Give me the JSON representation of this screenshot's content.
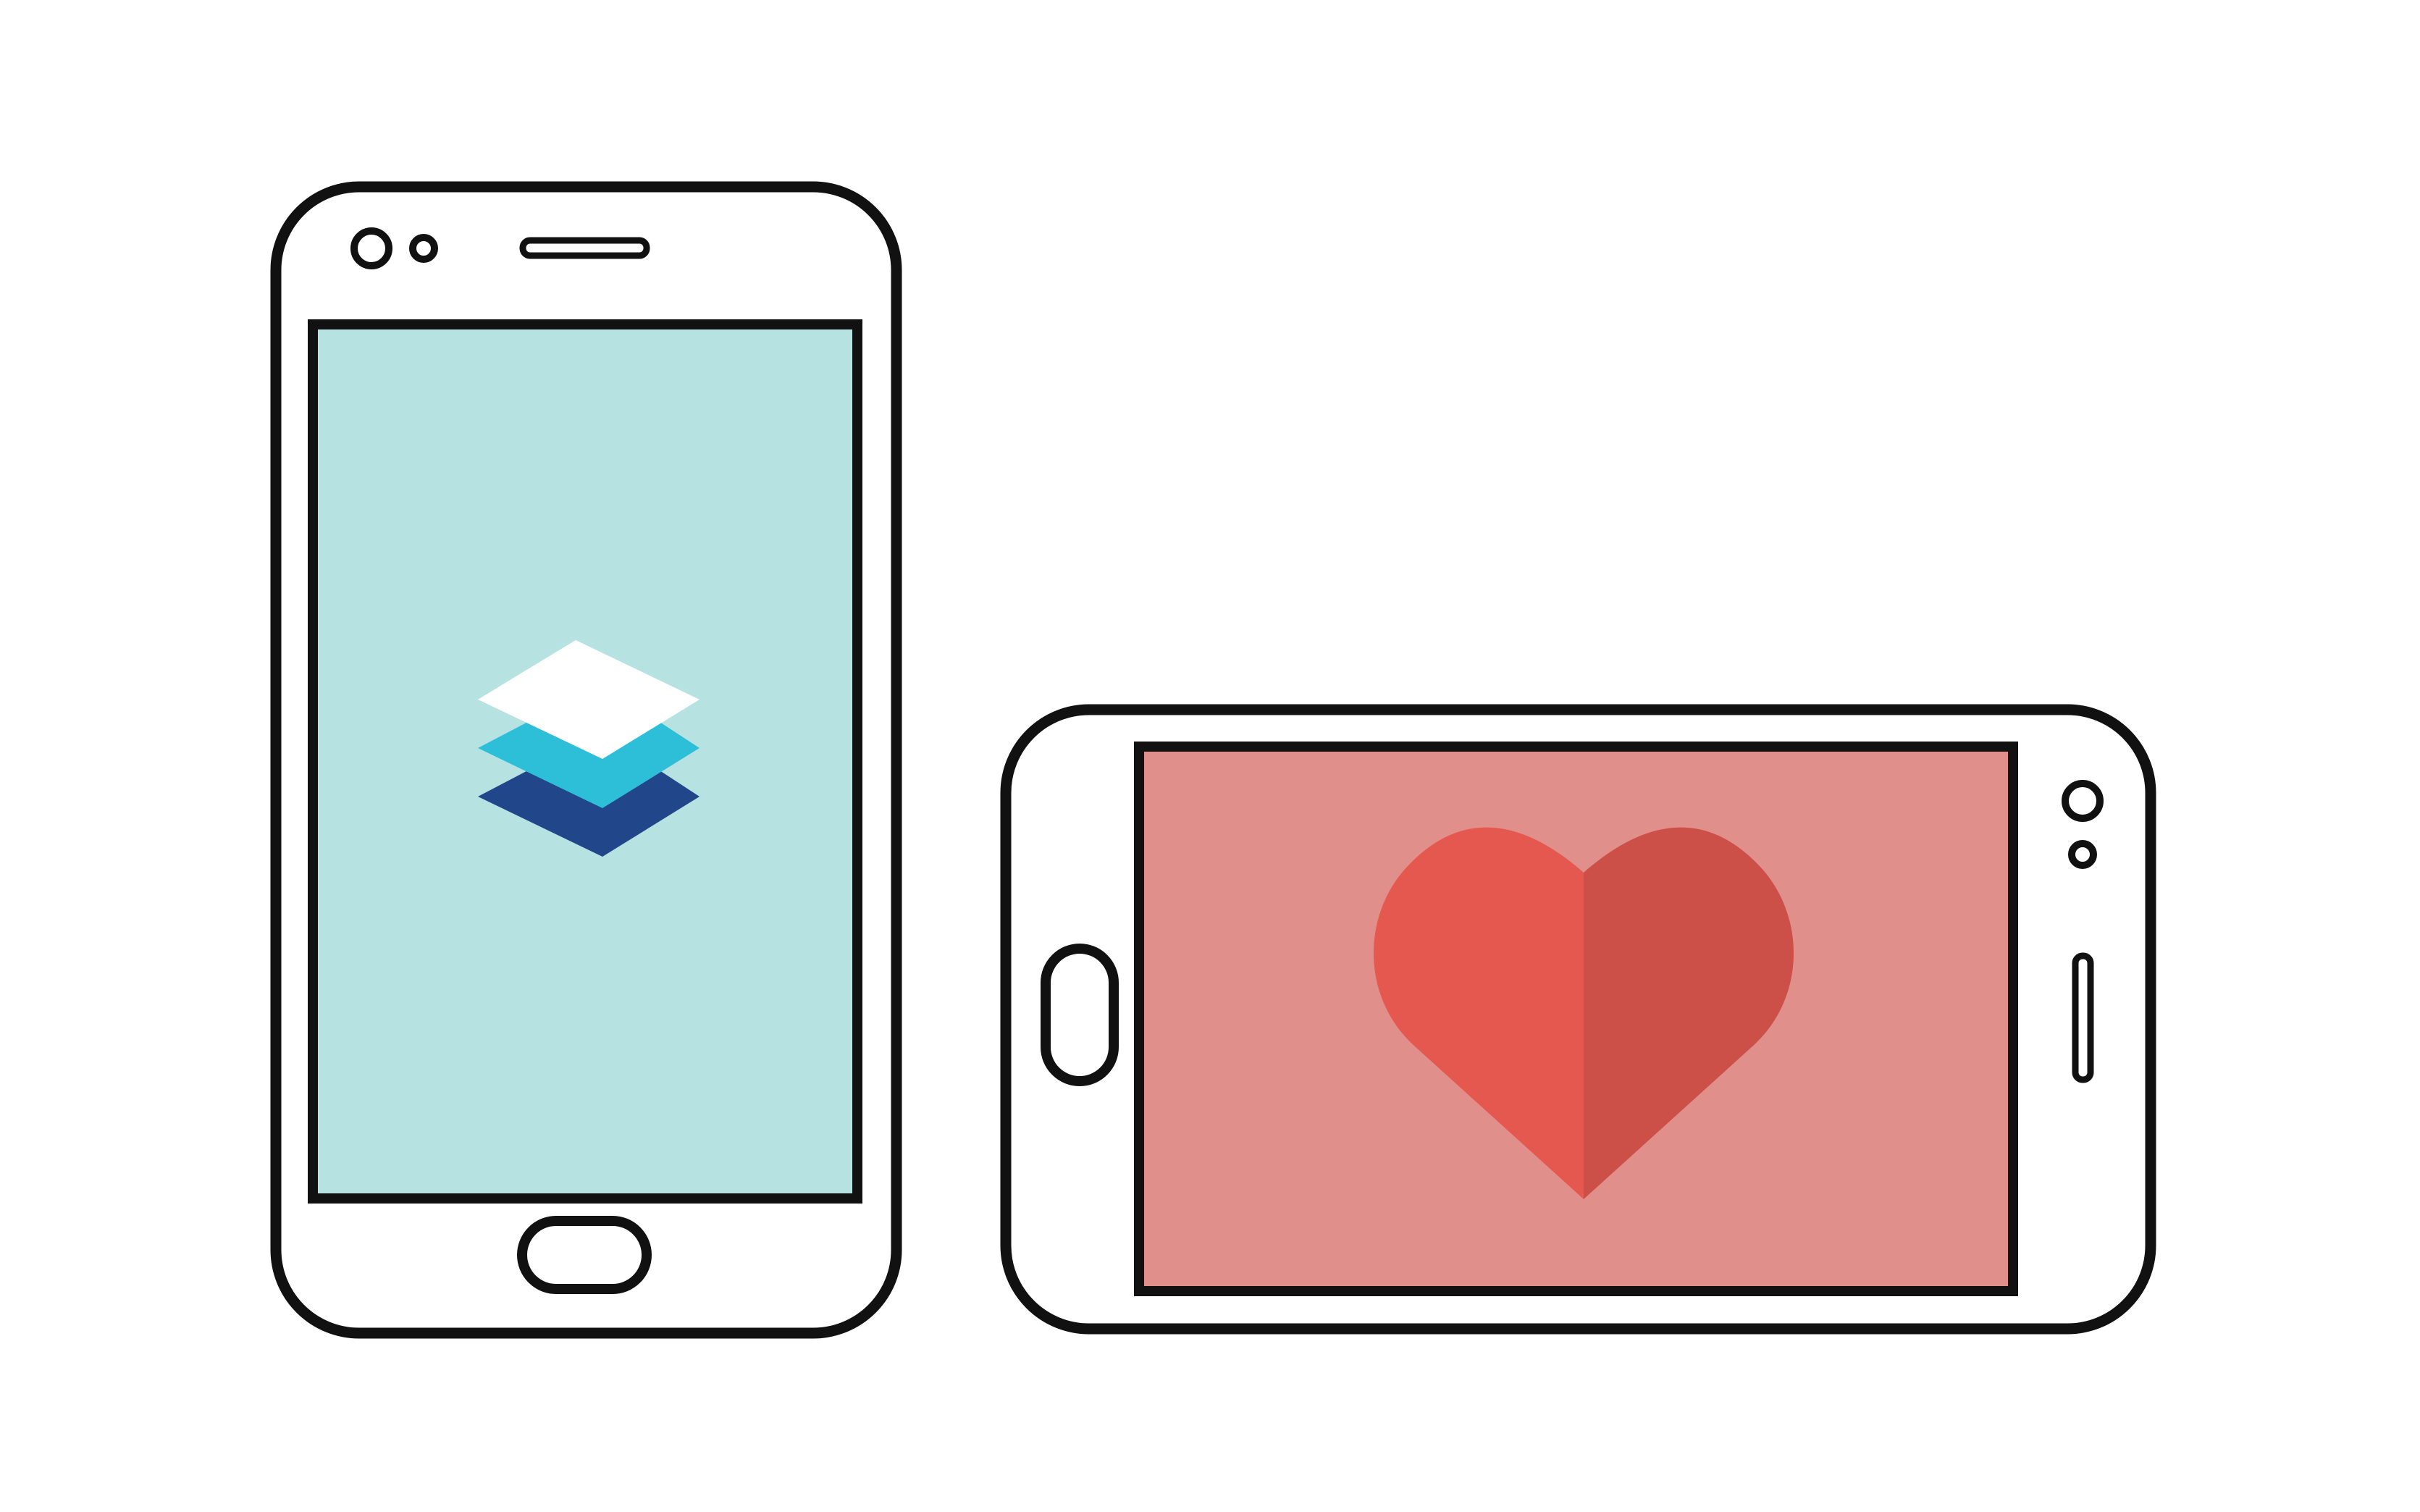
{
  "scene": {
    "background": "#ffffff",
    "outline_color": "#111111"
  },
  "portrait_phone": {
    "orientation": "portrait",
    "screen_color": "#b6e2e2",
    "screen_content": "layers-icon",
    "layer_colors": {
      "top": "#ffffff",
      "middle": "#2ebfd8",
      "bottom": "#21468a"
    }
  },
  "landscape_phone": {
    "orientation": "landscape",
    "screen_color": "#e08f8b",
    "screen_content": "heart-icon",
    "heart_colors": {
      "left": "#e55850",
      "right": "#cd5048"
    }
  }
}
